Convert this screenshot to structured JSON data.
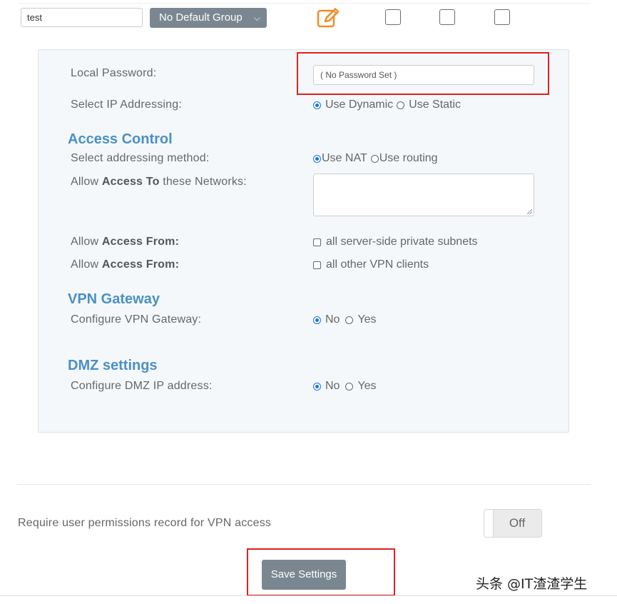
{
  "user_row": {
    "username_value": "test",
    "group_select_value": "No Default Group",
    "edit_icon": "edit-pencil-icon",
    "checkboxes": [
      false,
      false,
      false
    ]
  },
  "panel": {
    "local_password_label": "Local Password:",
    "local_password_placeholder": "( No Password Set )",
    "ip_addressing_label": "Select IP Addressing:",
    "ip_addressing_options": [
      "Use Dynamic",
      "Use Static"
    ],
    "ip_addressing_selected": "Use Dynamic",
    "access_control": {
      "heading": "Access Control",
      "method_label": "Select addressing method:",
      "method_options": [
        "Use NAT",
        "Use routing"
      ],
      "method_selected": "Use NAT",
      "access_to_prefix": "Allow ",
      "access_to_bold": "Access To",
      "access_to_suffix": " these Networks:",
      "networks_value": "",
      "access_from_prefix": "Allow ",
      "access_from_bold": "Access From:",
      "access_from_1_option": "all server-side private subnets",
      "access_from_2_option": "all other VPN clients"
    },
    "vpn_gateway": {
      "heading": "VPN Gateway",
      "label": "Configure VPN Gateway:",
      "options": [
        "No",
        "Yes"
      ],
      "selected": "No"
    },
    "dmz": {
      "heading": "DMZ settings",
      "label": "Configure DMZ IP address:",
      "options": [
        "No",
        "Yes"
      ],
      "selected": "No"
    }
  },
  "permissions": {
    "label": "Require user permissions record for VPN access",
    "toggle_label": "Off"
  },
  "save_button_label": "Save Settings",
  "watermark": "头条 @IT渣渣学生",
  "colors": {
    "accent_heading": "#4a90c6",
    "button_gray": "#7a8791",
    "edit_icon_orange": "#f08a24",
    "highlight_red": "#e02020",
    "radio_blue": "#1a73e8"
  }
}
